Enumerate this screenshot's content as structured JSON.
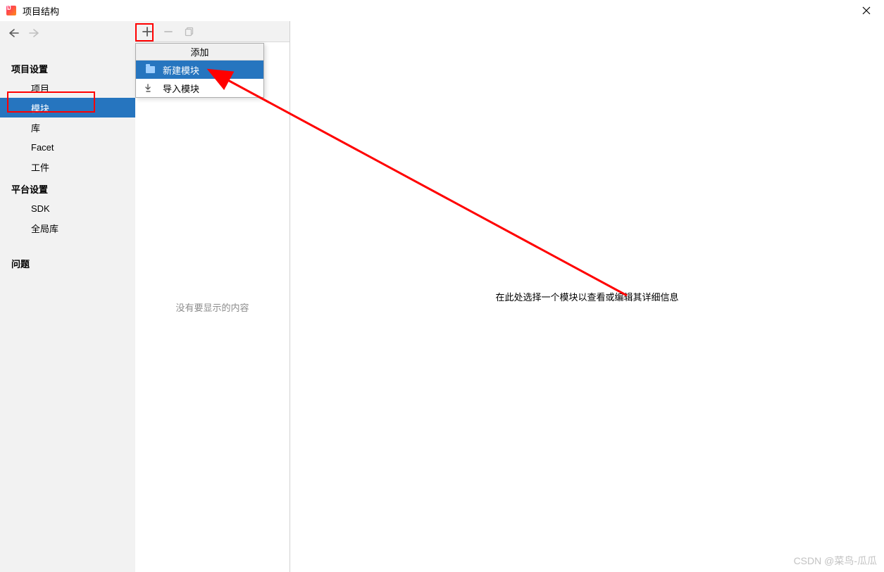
{
  "window": {
    "title": "项目结构"
  },
  "sidebar": {
    "sections": [
      {
        "header": "项目设置",
        "items": [
          "项目",
          "模块",
          "库",
          "Facet",
          "工件"
        ]
      },
      {
        "header": "平台设置",
        "items": [
          "SDK",
          "全局库"
        ]
      },
      {
        "header": "",
        "items": [
          "问题"
        ]
      }
    ]
  },
  "toolbar": {
    "add_tooltip": "添加",
    "remove_tooltip": "移除",
    "copy_tooltip": "复制"
  },
  "dropdown": {
    "header": "添加",
    "items": [
      {
        "label": "新建模块",
        "icon": "folder-icon",
        "selected": true
      },
      {
        "label": "导入模块",
        "icon": "import-icon",
        "selected": false
      }
    ]
  },
  "mid_panel": {
    "empty_text": "没有要显示的内容"
  },
  "right_panel": {
    "help_text": "在此处选择一个模块以查看或编辑其详细信息"
  },
  "watermark": "CSDN @菜鸟-瓜瓜"
}
